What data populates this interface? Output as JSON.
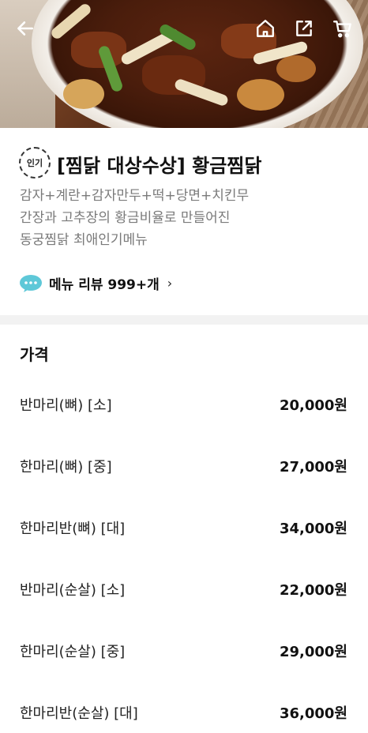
{
  "header": {
    "icons": [
      "back-arrow-icon",
      "home-icon",
      "share-icon",
      "cart-icon"
    ]
  },
  "menu": {
    "badge": "인기",
    "title": "[찜닭 대상수상] 황금찜닭",
    "description_lines": [
      "감자+계란+감자만두+떡+당면+치킨무",
      "간장과 고추장의 황금비율로 만들어진",
      "동궁찜닭 최애인기메뉴"
    ],
    "review_label": "메뉴 리뷰 999+개",
    "review_chevron": "›"
  },
  "price": {
    "section_title": "가격",
    "options": [
      {
        "name": "반마리(뼈) [소]",
        "price": "20,000원"
      },
      {
        "name": "한마리(뼈) [중]",
        "price": "27,000원"
      },
      {
        "name": "한마리반(뼈) [대]",
        "price": "34,000원"
      },
      {
        "name": "반마리(순살) [소]",
        "price": "22,000원"
      },
      {
        "name": "한마리(순살) [중]",
        "price": "29,000원"
      },
      {
        "name": "한마리반(순살) [대]",
        "price": "36,000원"
      }
    ]
  },
  "colors": {
    "accent_bubble": "#5ec8d8",
    "divider": "#f2f2f2",
    "description": "#7a7a7a"
  }
}
